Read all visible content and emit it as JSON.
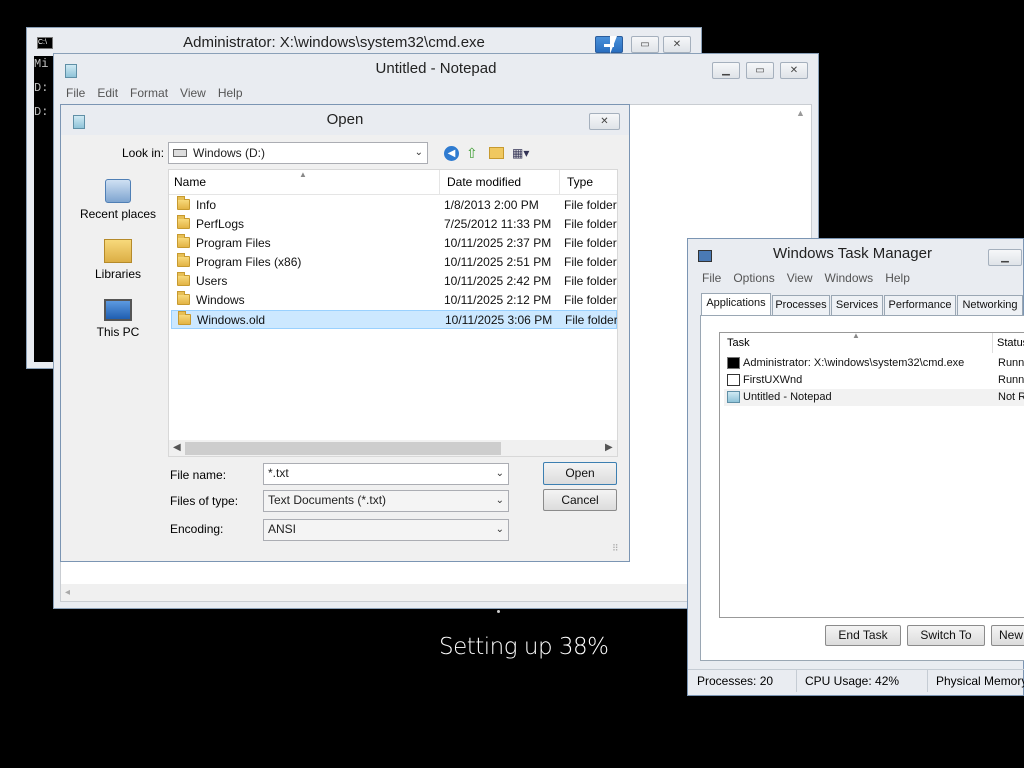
{
  "cmd": {
    "title": "Administrator: X:\\windows\\system32\\cmd.exe",
    "lines": [
      "Mi",
      "",
      "D:",
      "D:"
    ]
  },
  "notepad": {
    "title": "Untitled - Notepad",
    "menu": [
      "File",
      "Edit",
      "Format",
      "View",
      "Help"
    ]
  },
  "open_dialog": {
    "title": "Open",
    "look_in_label": "Look in:",
    "look_in_value": "Windows (D:)",
    "places": [
      "Recent places",
      "Libraries",
      "This PC"
    ],
    "columns": [
      "Name",
      "Date modified",
      "Type"
    ],
    "files": [
      {
        "name": "Info",
        "date": "1/8/2013 2:00 PM",
        "type": "File folder"
      },
      {
        "name": "PerfLogs",
        "date": "7/25/2012 11:33 PM",
        "type": "File folder"
      },
      {
        "name": "Program Files",
        "date": "10/11/2025 2:37 PM",
        "type": "File folder"
      },
      {
        "name": "Program Files (x86)",
        "date": "10/11/2025 2:51 PM",
        "type": "File folder"
      },
      {
        "name": "Users",
        "date": "10/11/2025 2:42 PM",
        "type": "File folder"
      },
      {
        "name": "Windows",
        "date": "10/11/2025 2:12 PM",
        "type": "File folder"
      },
      {
        "name": "Windows.old",
        "date": "10/11/2025 3:06 PM",
        "type": "File folder",
        "selected": true
      }
    ],
    "file_name_label": "File name:",
    "file_name_value": "*.txt",
    "files_of_type_label": "Files of type:",
    "files_of_type_value": "Text Documents (*.txt)",
    "encoding_label": "Encoding:",
    "encoding_value": "ANSI",
    "open_button": "Open",
    "cancel_button": "Cancel"
  },
  "setup_text": "Setting up 38%",
  "task_manager": {
    "title": "Windows Task Manager",
    "menu": [
      "File",
      "Options",
      "View",
      "Windows",
      "Help"
    ],
    "tabs": [
      "Applications",
      "Processes",
      "Services",
      "Performance",
      "Networking"
    ],
    "columns": [
      "Task",
      "Status"
    ],
    "tasks": [
      {
        "name": "Administrator: X:\\windows\\system32\\cmd.exe",
        "status": "Runni",
        "icon": "cmd-icon"
      },
      {
        "name": "FirstUXWnd",
        "status": "Runni",
        "icon": "window-icon"
      },
      {
        "name": "Untitled - Notepad",
        "status": "Not R",
        "icon": "notepad-icon"
      }
    ],
    "buttons": [
      "End Task",
      "Switch To",
      "New"
    ],
    "status": {
      "processes": "Processes: 20",
      "cpu": "CPU Usage: 42%",
      "memory": "Physical Memory"
    }
  },
  "colors": {
    "selection": "#cce8ff",
    "desktop": "#000000",
    "window_frame": "#e9ecf1"
  }
}
